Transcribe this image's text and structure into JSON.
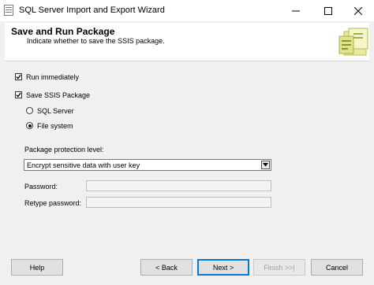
{
  "window": {
    "title": "SQL Server Import and Export Wizard"
  },
  "header": {
    "title": "Save and Run Package",
    "subtitle": "Indicate whether to save the SSIS package."
  },
  "options": {
    "run_immediately": {
      "label": "Run immediately",
      "checked": true
    },
    "save_ssis_package": {
      "label": "Save SSIS Package",
      "checked": true
    },
    "sql_server": {
      "label": "SQL Server",
      "selected": false
    },
    "file_system": {
      "label": "File system",
      "selected": true
    }
  },
  "protection": {
    "label": "Package protection level:",
    "selected": "Encrypt sensitive data with user key"
  },
  "password": {
    "label": "Password:",
    "value": ""
  },
  "retype_password": {
    "label": "Retype password:",
    "value": ""
  },
  "buttons": {
    "help": "Help",
    "back": "< Back",
    "next": "Next >",
    "finish": "Finish >>|",
    "cancel": "Cancel"
  },
  "colors": {
    "accent": "#0078d7",
    "window_bg": "#f0f0f0"
  }
}
